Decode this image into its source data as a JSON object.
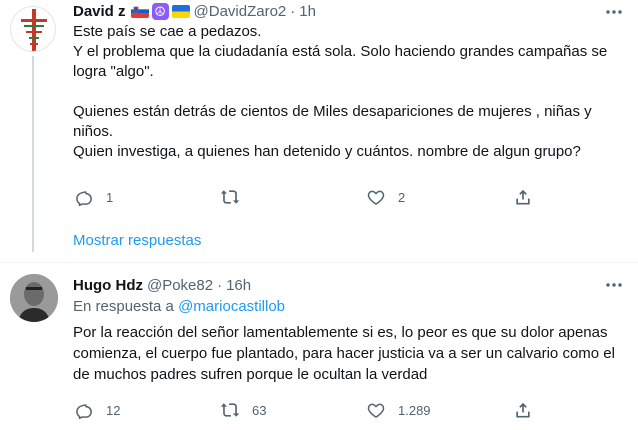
{
  "tweets": [
    {
      "name": "David z",
      "handle": "@DavidZaro2",
      "separator": "·",
      "time": "1h",
      "paragraphs": [
        [
          "Este país se cae a pedazos.",
          "Y el problema que la ciudadanía está sola. Solo haciendo grandes campañas se logra \"algo\"."
        ],
        [
          "Quienes están detrás de cientos de Miles desapariciones de mujeres , niñas y niños.",
          "Quien investiga, a quienes han detenido y cuántos. nombre de algun grupo?"
        ]
      ],
      "replies": "1",
      "retweets": "",
      "likes": "2",
      "show_replies_label": "Mostrar respuestas",
      "avatar_text": "JESÚS EN LA CRUZ"
    },
    {
      "name": "Hugo Hdz",
      "handle": "@Poke82",
      "separator": "·",
      "time": "16h",
      "reply_prefix": "En respuesta a",
      "reply_to": "@mariocastillob",
      "text": "Por la reacción del señor lamentablemente si es, lo peor es que su dolor apenas comienza, el cuerpo fue plantado, para hacer justicia va a ser un calvario como el de muchos padres sufren porque le ocultan la verdad",
      "replies": "12",
      "retweets": "63",
      "likes": "1.289"
    }
  ],
  "icons": {
    "more": "more-icon",
    "reply": "reply-icon",
    "retweet": "retweet-icon",
    "like": "like-icon",
    "share": "share-icon"
  },
  "colors": {
    "link": "#1d9bf0",
    "secondary_text": "#536471",
    "primary_text": "#0f1419",
    "thread_line": "#cfd9de",
    "divider": "#eff3f4"
  }
}
